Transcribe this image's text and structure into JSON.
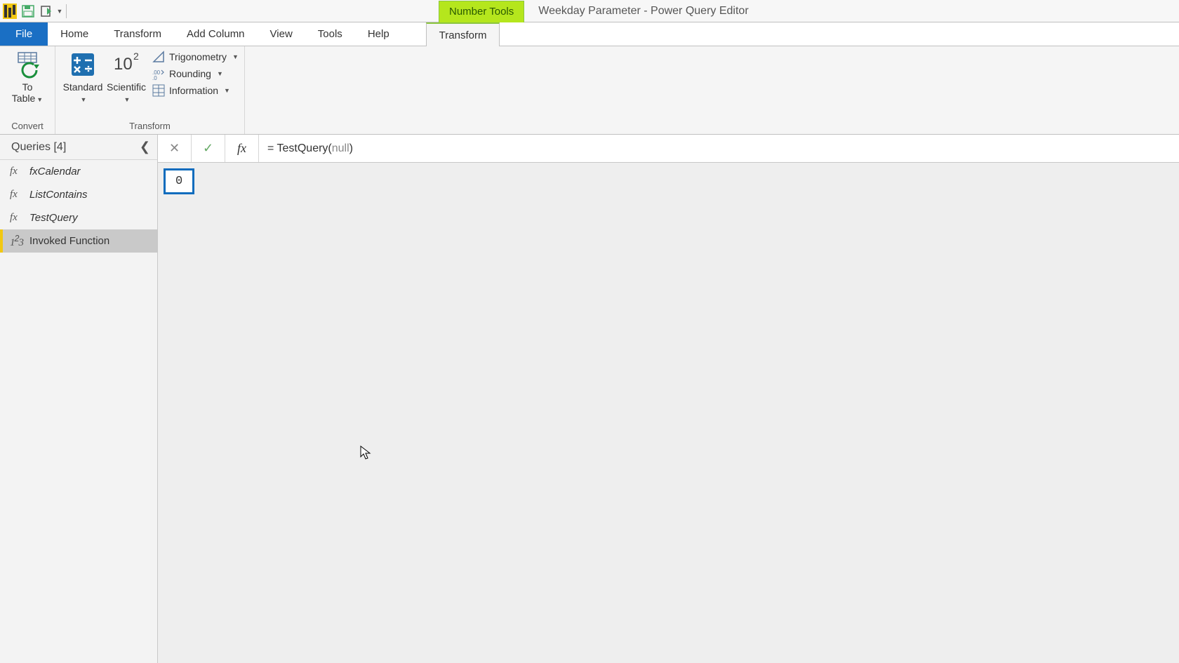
{
  "titlebar": {
    "contextual_group": "Number Tools",
    "app_title": "Weekday Parameter - Power Query Editor"
  },
  "tabs": {
    "file": "File",
    "home": "Home",
    "transform": "Transform",
    "add_column": "Add Column",
    "view": "View",
    "tools": "Tools",
    "help": "Help",
    "ctx_transform": "Transform"
  },
  "ribbon": {
    "group_convert": "Convert",
    "to_table": "To\nTable",
    "group_transform": "Transform",
    "standard": "Standard",
    "scientific": "Scientific",
    "trigonometry": "Trigonometry",
    "rounding": "Rounding",
    "information": "Information"
  },
  "queries": {
    "header": "Queries [4]",
    "items": [
      {
        "icon": "fx",
        "label": "fxCalendar",
        "type": "fn"
      },
      {
        "icon": "fx",
        "label": "ListContains",
        "type": "fn"
      },
      {
        "icon": "fx",
        "label": "TestQuery",
        "type": "fn"
      },
      {
        "icon": "123",
        "label": "Invoked Function",
        "type": "num",
        "selected": true
      }
    ]
  },
  "formula": {
    "prefix": "= TestQuery(",
    "null_kw": "null",
    "suffix": ")"
  },
  "result": {
    "value": "0"
  }
}
